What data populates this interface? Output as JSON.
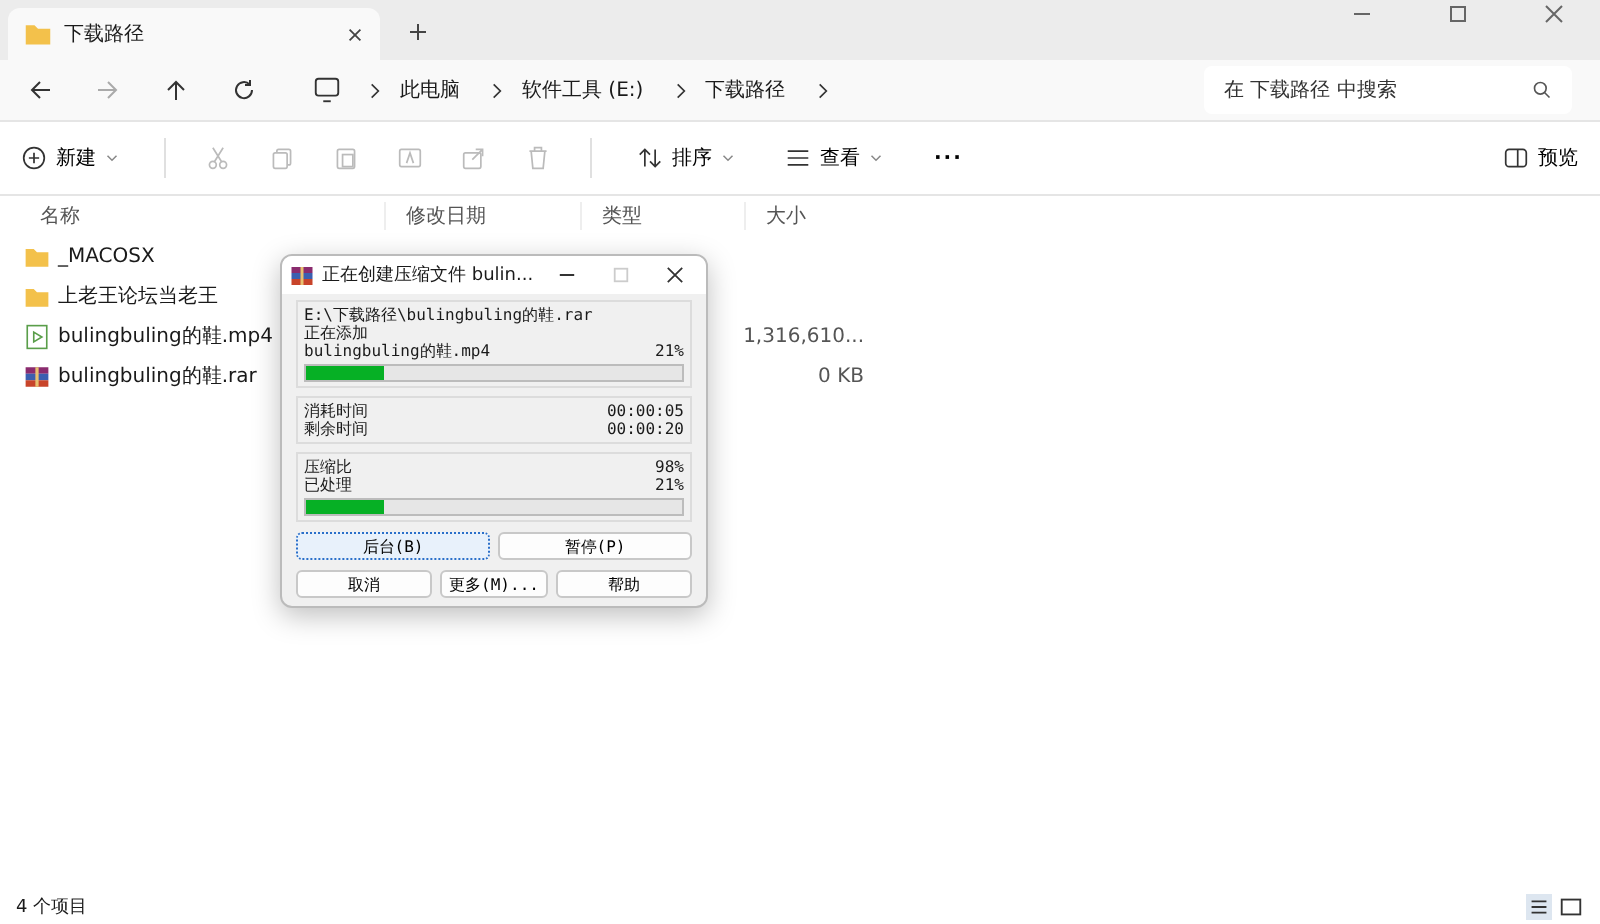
{
  "tab": {
    "title": "下载路径"
  },
  "breadcrumb": [
    "此电脑",
    "软件工具 (E:)",
    "下载路径"
  ],
  "search": {
    "placeholder": "在 下载路径 中搜索"
  },
  "toolbar": {
    "new": "新建",
    "sort": "排序",
    "view": "查看",
    "more": "···",
    "preview": "预览"
  },
  "columns": [
    "名称",
    "修改日期",
    "类型",
    "大小"
  ],
  "files": [
    {
      "kind": "folder",
      "name": "_MACOSX"
    },
    {
      "kind": "folder",
      "name": "上老王论坛当老王"
    },
    {
      "kind": "video",
      "name": "bulingbuling的鞋.mp4",
      "size": "1,316,610..."
    },
    {
      "kind": "archive",
      "name": "bulingbuling的鞋.rar",
      "size": "0 KB"
    }
  ],
  "status_bar": {
    "count": "4 个项目"
  },
  "dialog": {
    "title": "正在创建压缩文件 bulin...",
    "archive_path": "E:\\下载路径\\bulingbuling的鞋.rar",
    "action": "正在添加",
    "current_file": "bulingbuling的鞋.mp4",
    "file_percent": "21%",
    "file_progress": {
      "level": 0.21
    },
    "times": [
      {
        "label": "消耗时间",
        "value": "00:00:05"
      },
      {
        "label": "剩余时间",
        "value": "00:00:20"
      }
    ],
    "stats": [
      {
        "label": "压缩比",
        "value": "98%"
      },
      {
        "label": "已处理",
        "value": "21%"
      }
    ],
    "total_progress": {
      "level": 0.21
    },
    "buttons": [
      {
        "label": "后台(B)",
        "focused": true
      },
      {
        "label": "暂停(P)",
        "focused": false
      },
      {
        "label": "取消",
        "focused": false
      },
      {
        "label": "更多(M)...",
        "focused": false
      },
      {
        "label": "帮助",
        "focused": false
      }
    ]
  }
}
